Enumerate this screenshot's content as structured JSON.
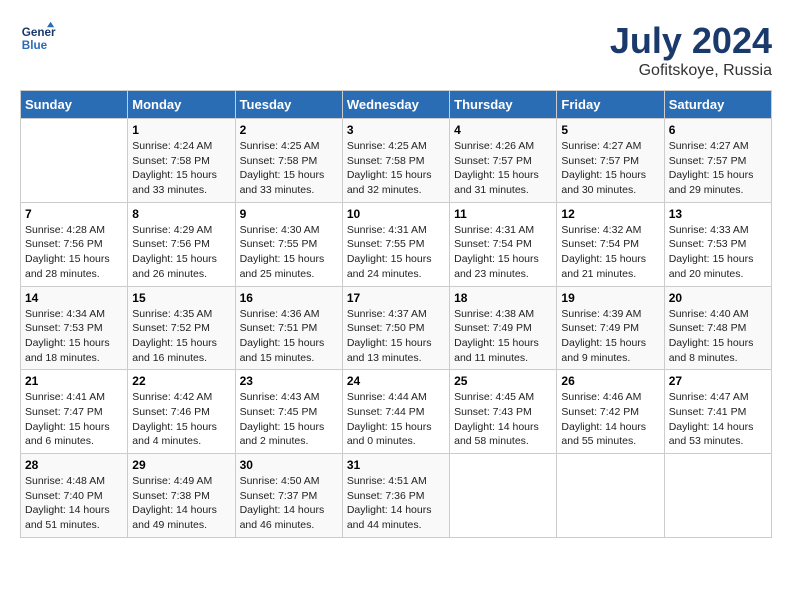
{
  "header": {
    "logo_line1": "General",
    "logo_line2": "Blue",
    "title": "July 2024",
    "subtitle": "Gofitskoye, Russia"
  },
  "columns": [
    "Sunday",
    "Monday",
    "Tuesday",
    "Wednesday",
    "Thursday",
    "Friday",
    "Saturday"
  ],
  "weeks": [
    [
      {
        "num": "",
        "info": ""
      },
      {
        "num": "1",
        "info": "Sunrise: 4:24 AM\nSunset: 7:58 PM\nDaylight: 15 hours\nand 33 minutes."
      },
      {
        "num": "2",
        "info": "Sunrise: 4:25 AM\nSunset: 7:58 PM\nDaylight: 15 hours\nand 33 minutes."
      },
      {
        "num": "3",
        "info": "Sunrise: 4:25 AM\nSunset: 7:58 PM\nDaylight: 15 hours\nand 32 minutes."
      },
      {
        "num": "4",
        "info": "Sunrise: 4:26 AM\nSunset: 7:57 PM\nDaylight: 15 hours\nand 31 minutes."
      },
      {
        "num": "5",
        "info": "Sunrise: 4:27 AM\nSunset: 7:57 PM\nDaylight: 15 hours\nand 30 minutes."
      },
      {
        "num": "6",
        "info": "Sunrise: 4:27 AM\nSunset: 7:57 PM\nDaylight: 15 hours\nand 29 minutes."
      }
    ],
    [
      {
        "num": "7",
        "info": "Sunrise: 4:28 AM\nSunset: 7:56 PM\nDaylight: 15 hours\nand 28 minutes."
      },
      {
        "num": "8",
        "info": "Sunrise: 4:29 AM\nSunset: 7:56 PM\nDaylight: 15 hours\nand 26 minutes."
      },
      {
        "num": "9",
        "info": "Sunrise: 4:30 AM\nSunset: 7:55 PM\nDaylight: 15 hours\nand 25 minutes."
      },
      {
        "num": "10",
        "info": "Sunrise: 4:31 AM\nSunset: 7:55 PM\nDaylight: 15 hours\nand 24 minutes."
      },
      {
        "num": "11",
        "info": "Sunrise: 4:31 AM\nSunset: 7:54 PM\nDaylight: 15 hours\nand 23 minutes."
      },
      {
        "num": "12",
        "info": "Sunrise: 4:32 AM\nSunset: 7:54 PM\nDaylight: 15 hours\nand 21 minutes."
      },
      {
        "num": "13",
        "info": "Sunrise: 4:33 AM\nSunset: 7:53 PM\nDaylight: 15 hours\nand 20 minutes."
      }
    ],
    [
      {
        "num": "14",
        "info": "Sunrise: 4:34 AM\nSunset: 7:53 PM\nDaylight: 15 hours\nand 18 minutes."
      },
      {
        "num": "15",
        "info": "Sunrise: 4:35 AM\nSunset: 7:52 PM\nDaylight: 15 hours\nand 16 minutes."
      },
      {
        "num": "16",
        "info": "Sunrise: 4:36 AM\nSunset: 7:51 PM\nDaylight: 15 hours\nand 15 minutes."
      },
      {
        "num": "17",
        "info": "Sunrise: 4:37 AM\nSunset: 7:50 PM\nDaylight: 15 hours\nand 13 minutes."
      },
      {
        "num": "18",
        "info": "Sunrise: 4:38 AM\nSunset: 7:49 PM\nDaylight: 15 hours\nand 11 minutes."
      },
      {
        "num": "19",
        "info": "Sunrise: 4:39 AM\nSunset: 7:49 PM\nDaylight: 15 hours\nand 9 minutes."
      },
      {
        "num": "20",
        "info": "Sunrise: 4:40 AM\nSunset: 7:48 PM\nDaylight: 15 hours\nand 8 minutes."
      }
    ],
    [
      {
        "num": "21",
        "info": "Sunrise: 4:41 AM\nSunset: 7:47 PM\nDaylight: 15 hours\nand 6 minutes."
      },
      {
        "num": "22",
        "info": "Sunrise: 4:42 AM\nSunset: 7:46 PM\nDaylight: 15 hours\nand 4 minutes."
      },
      {
        "num": "23",
        "info": "Sunrise: 4:43 AM\nSunset: 7:45 PM\nDaylight: 15 hours\nand 2 minutes."
      },
      {
        "num": "24",
        "info": "Sunrise: 4:44 AM\nSunset: 7:44 PM\nDaylight: 15 hours\nand 0 minutes."
      },
      {
        "num": "25",
        "info": "Sunrise: 4:45 AM\nSunset: 7:43 PM\nDaylight: 14 hours\nand 58 minutes."
      },
      {
        "num": "26",
        "info": "Sunrise: 4:46 AM\nSunset: 7:42 PM\nDaylight: 14 hours\nand 55 minutes."
      },
      {
        "num": "27",
        "info": "Sunrise: 4:47 AM\nSunset: 7:41 PM\nDaylight: 14 hours\nand 53 minutes."
      }
    ],
    [
      {
        "num": "28",
        "info": "Sunrise: 4:48 AM\nSunset: 7:40 PM\nDaylight: 14 hours\nand 51 minutes."
      },
      {
        "num": "29",
        "info": "Sunrise: 4:49 AM\nSunset: 7:38 PM\nDaylight: 14 hours\nand 49 minutes."
      },
      {
        "num": "30",
        "info": "Sunrise: 4:50 AM\nSunset: 7:37 PM\nDaylight: 14 hours\nand 46 minutes."
      },
      {
        "num": "31",
        "info": "Sunrise: 4:51 AM\nSunset: 7:36 PM\nDaylight: 14 hours\nand 44 minutes."
      },
      {
        "num": "",
        "info": ""
      },
      {
        "num": "",
        "info": ""
      },
      {
        "num": "",
        "info": ""
      }
    ]
  ]
}
